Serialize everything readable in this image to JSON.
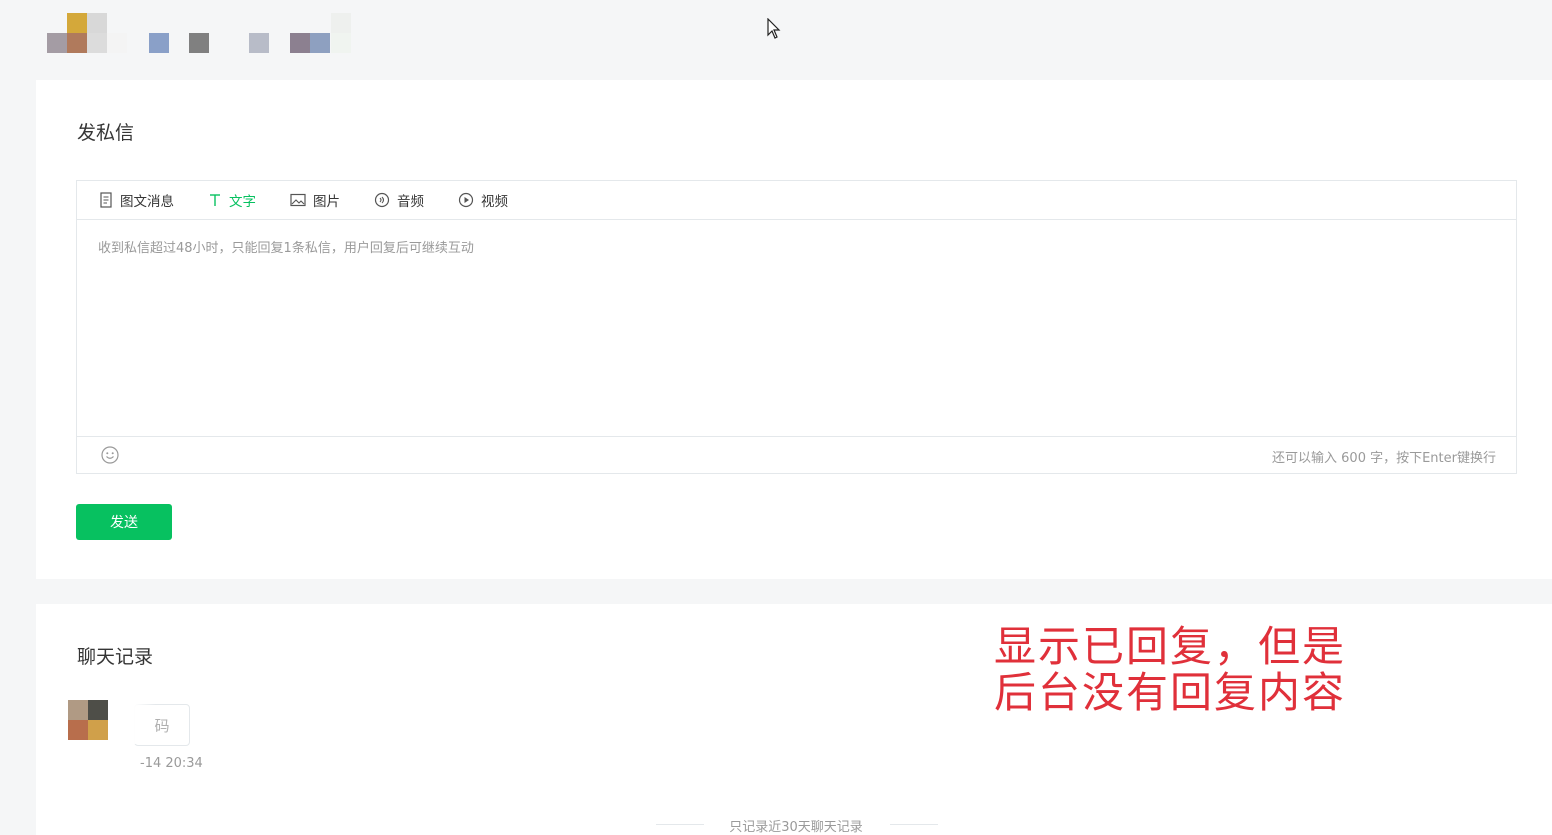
{
  "send_section": {
    "title": "发私信",
    "tabs": [
      {
        "label": "图文消息",
        "icon": "article-icon",
        "active": false
      },
      {
        "label": "文字",
        "icon": "text-icon",
        "active": true
      },
      {
        "label": "图片",
        "icon": "image-icon",
        "active": false
      },
      {
        "label": "音频",
        "icon": "audio-icon",
        "active": false
      },
      {
        "label": "视频",
        "icon": "video-icon",
        "active": false
      }
    ],
    "placeholder": "收到私信超过48小时，只能回复1条私信，用户回复后可继续互动",
    "counter": "还可以输入 600 字，按下Enter键换行",
    "send_button": "发送"
  },
  "history_section": {
    "title": "聊天记录",
    "message_text": "码",
    "message_time": "-14 20:34",
    "note": "只记录近30天聊天记录"
  },
  "annotation": {
    "line1": "显示已回复，但是",
    "line2": "后台没有回复内容"
  },
  "colors": {
    "accent": "#07c160",
    "annotation": "#e0303a",
    "page_bg": "#f5f6f7"
  }
}
